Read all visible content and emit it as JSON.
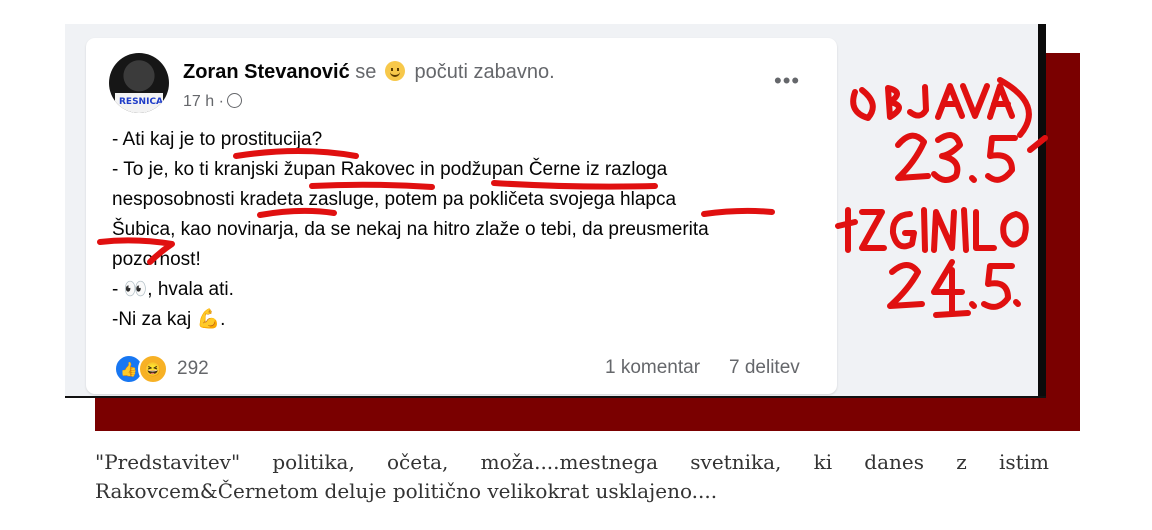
{
  "post": {
    "author": "Zoran Stevanović",
    "feeling_prefix": "se",
    "feeling_text": "počuti zabavno.",
    "time": "17 h ·",
    "avatar_text": "RESNICA",
    "lines": [
      "- Ati kaj je to prostitucija?",
      "- To je, ko ti kranjski župan Rakovec in podžupan Černe iz razloga",
      "nesposobnosti kradeta zasluge, potem pa pokličeta svojega hlapca",
      "Šubica, kao novinarja, da se nekaj na hitro zlaže o tebi, da preusmerita",
      "pozornost!",
      "- 👀, hvala ati.",
      "-Ni za kaj 💪."
    ],
    "reaction_count": "292",
    "comments": "1 komentar",
    "shares": "7 delitev"
  },
  "annotations": {
    "line1": "OBJAVA",
    "line2": "23.5",
    "line3": "IZGINILO",
    "line4": "24.5.",
    "color": "#e01010"
  },
  "caption": "\"Predstavitev\" politika, očeta, moža....mestnega svetnika, ki danes z istim Rakovcem&Černetom deluje politično velikokrat usklajeno...."
}
